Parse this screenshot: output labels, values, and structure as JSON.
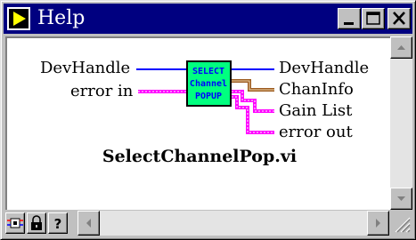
{
  "window": {
    "title": "Help",
    "buttons": [
      "minimize",
      "maximize",
      "close"
    ]
  },
  "vi_icon": {
    "line1": "SELECT",
    "line2": "Channel",
    "line3": "POPUP"
  },
  "terminals": {
    "inputs": [
      "DevHandle",
      "error in"
    ],
    "outputs": [
      "DevHandle",
      "ChanInfo",
      "Gain List",
      "error out"
    ]
  },
  "vi_name": "SelectChannelPop.vi",
  "toolbar": {
    "icons": [
      "simple-diagram-help-icon",
      "lock-icon",
      "question-icon"
    ]
  },
  "colors": {
    "title_bar": "#000080",
    "numeric_wire": "#0000ff",
    "cluster_wire": "#ff00ff",
    "array_wire": "#9c5a1e",
    "vi_icon_bg": "#00ff7f"
  }
}
